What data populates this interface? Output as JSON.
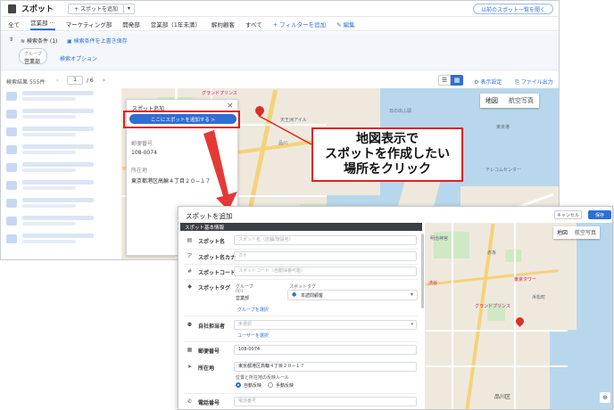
{
  "back_screen": {
    "title": "スポット",
    "add_spot_button": "+ スポットを追加",
    "open_old_list_button": "以前のスポット一覧を開く",
    "tabs": [
      "全て",
      "営業部",
      "マーケティング部",
      "開発部",
      "営業部（1年未満）",
      "解約顧客",
      "すべて"
    ],
    "add_filter": "+ フィルターを追加",
    "edit": "編集",
    "search_conditions": "検索条件 (1)",
    "overwrite_save": "検索条件を上書き保存",
    "group_label": "グループ",
    "group_value": "営業部",
    "search_options": "検索オプション",
    "result_label": "検索結果",
    "result_count": "555件",
    "page_current": "1",
    "page_total": "/ 6",
    "display_settings": "表示設定",
    "file_output": "ファイル出力"
  },
  "map_popup": {
    "title": "スポット追加",
    "add_here_button": "ここにスポットを追加する >",
    "postal_label": "郵便番号",
    "postal_value": "108-0074",
    "address_label": "所在地",
    "address_value": "東京都港区高輪４丁目２０−１７"
  },
  "map_back": {
    "map_type": "地図",
    "satellite_type": "航空写真",
    "labels": [
      "グランドプリンス",
      "日の出ふ頭",
      "品川",
      "天王洲アイル",
      "テレコムセンター",
      "東京港"
    ]
  },
  "callout": {
    "line1": "地図表示で",
    "line2": "スポットを作成したい",
    "line3": "場所をクリック"
  },
  "front_panel": {
    "title": "スポットを追加",
    "cancel_button": "キャンセル",
    "save_button": "保存",
    "section_header": "スポット基本情報",
    "fields": {
      "spot_name_label": "スポット名",
      "spot_name_placeholder": "スポット名（店舗/施設名）",
      "spot_kana_label": "スポット名カナ",
      "spot_kana_placeholder": "カナ",
      "spot_code_label": "スポットコード",
      "spot_code_placeholder": "スポットコード（自動採番可能）",
      "spot_tag_label": "スポットタグ",
      "group_sub": "グループ",
      "spot_tag_sub": "スポットタグ",
      "group_code": "001",
      "group_name": "営業部",
      "tag_value": "本読問顧客",
      "select_group": "グループを選択",
      "owner_label": "自社担当者",
      "owner_placeholder": "未選択",
      "select_user": "ユーザーを選択",
      "postal_label": "郵便番号",
      "postal_value": "108-0074",
      "address_label": "所在地",
      "address_value": "東京都港区高輪４丁目２０−１７",
      "sync_rule": "位置と所在地の反映ルール",
      "auto_sync": "自動反映",
      "manual_sync": "手動反映",
      "phone_label": "電話番号",
      "phone_placeholder": "電話番号"
    },
    "map_type": "地図",
    "satellite_type": "航空写真",
    "map_labels": [
      "明治神宮",
      "渋谷",
      "東京タワー",
      "グランドプリンス",
      "品川区",
      "浜松町",
      "赤坂"
    ]
  },
  "colors": {
    "accent": "#2f6fd4",
    "callout_border": "#e02020",
    "arrow": "#e53935",
    "front_header": "#3b3f46"
  }
}
